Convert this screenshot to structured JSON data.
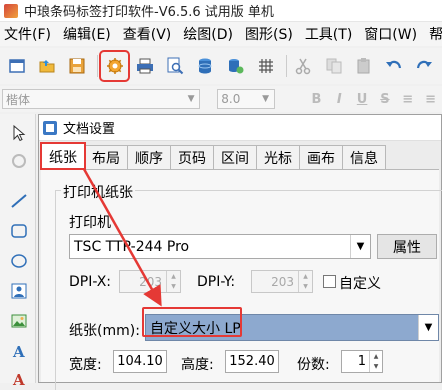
{
  "window": {
    "title": "中琅条码标签打印软件-V6.5.6 试用版 单机"
  },
  "menu": [
    "文件(F)",
    "编辑(E)",
    "查看(V)",
    "绘图(D)",
    "图形(S)",
    "工具(T)",
    "窗口(W)",
    "帮"
  ],
  "toolbar": {
    "icons": [
      "new-icon",
      "open-icon",
      "save-icon",
      "document-settings-icon",
      "print-icon",
      "print-preview-icon",
      "database-icon",
      "database-settings-icon",
      "grid-icon",
      "cut-icon",
      "copy-icon",
      "paste-icon",
      "undo-icon",
      "redo-icon"
    ],
    "highlighted": "document-settings-icon"
  },
  "fontbar": {
    "font_name": "楷体",
    "font_size": "8.0",
    "bold": "B",
    "italic": "I",
    "underline": "U",
    "strike": "S"
  },
  "leftbar": {
    "icons": [
      "select-arrow-icon",
      "rotate-icon",
      "line-icon",
      "rectangle-icon",
      "ellipse-icon",
      "image-icon",
      "picture-icon",
      "text-icon",
      "rich-text-icon"
    ]
  },
  "dialog": {
    "title": "文档设置",
    "tabs": [
      "纸张",
      "布局",
      "顺序",
      "页码",
      "区间",
      "光标",
      "画布",
      "信息"
    ],
    "active_tab": "纸张",
    "printer_paper_group": "打印机纸张",
    "printer_label": "打印机",
    "printer_value": "TSC TTP-244 Pro",
    "properties_button": "属性",
    "dpi_x_label": "DPI-X:",
    "dpi_x_value": "203",
    "dpi_y_label": "DPI-Y:",
    "dpi_y_value": "203",
    "custom_label": "自定义",
    "paper_label": "纸张(mm):",
    "paper_value": "自定义大小 LP",
    "width_label": "宽度:",
    "width_value": "104.10",
    "height_label": "高度:",
    "height_value": "152.40",
    "copies_label": "份数:",
    "copies_value": "1"
  },
  "colors": {
    "annotation_red": "#e53935",
    "selection_blue": "#8da9cf"
  }
}
